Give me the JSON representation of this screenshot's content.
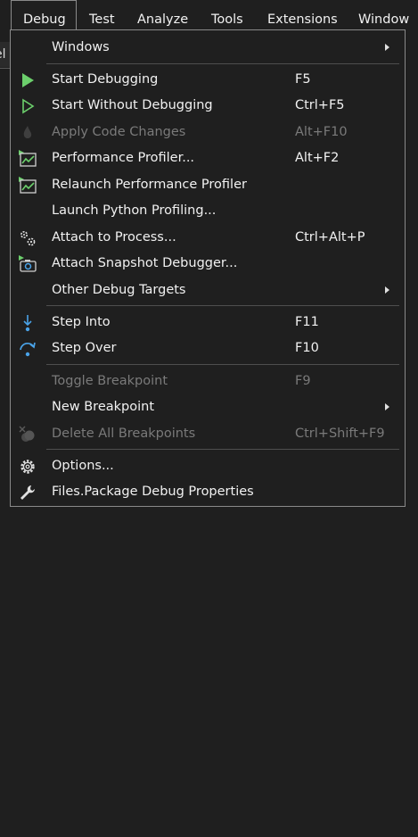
{
  "menubar": {
    "items": [
      {
        "label": "Debug"
      },
      {
        "label": "Test"
      },
      {
        "label": "Analyze"
      },
      {
        "label": "Tools"
      },
      {
        "label": "Extensions"
      },
      {
        "label": "Window"
      }
    ]
  },
  "background_tab_fragment": "el",
  "menu": {
    "items": [
      {
        "label": "Windows",
        "shortcut": "",
        "submenu": true
      },
      {
        "label": "Start Debugging",
        "shortcut": "F5",
        "icon": "play-filled-icon"
      },
      {
        "label": "Start Without Debugging",
        "shortcut": "Ctrl+F5",
        "icon": "play-outline-icon"
      },
      {
        "label": "Apply Code Changes",
        "shortcut": "Alt+F10",
        "icon": "flame-icon",
        "disabled": true
      },
      {
        "label": "Performance Profiler...",
        "shortcut": "Alt+F2",
        "icon": "performance-profiler-icon"
      },
      {
        "label": "Relaunch Performance Profiler",
        "shortcut": "",
        "icon": "relaunch-profiler-icon"
      },
      {
        "label": "Launch Python Profiling...",
        "shortcut": ""
      },
      {
        "label": "Attach to Process...",
        "shortcut": "Ctrl+Alt+P",
        "icon": "gears-icon"
      },
      {
        "label": "Attach Snapshot Debugger...",
        "shortcut": "",
        "icon": "camera-play-icon"
      },
      {
        "label": "Other Debug Targets",
        "shortcut": "",
        "submenu": true
      },
      {
        "label": "Step Into",
        "shortcut": "F11",
        "icon": "step-into-icon"
      },
      {
        "label": "Step Over",
        "shortcut": "F10",
        "icon": "step-over-icon"
      },
      {
        "label": "Toggle Breakpoint",
        "shortcut": "F9",
        "disabled": true
      },
      {
        "label": "New Breakpoint",
        "shortcut": "",
        "submenu": true
      },
      {
        "label": "Delete All Breakpoints",
        "shortcut": "Ctrl+Shift+F9",
        "icon": "delete-breakpoints-icon",
        "disabled": true
      },
      {
        "label": "Options...",
        "shortcut": "",
        "icon": "gear-icon"
      },
      {
        "label": "Files.Package Debug Properties",
        "shortcut": "",
        "icon": "wrench-icon"
      }
    ]
  },
  "colors": {
    "background": "#1f1f1f",
    "text": "#f1f1f1",
    "disabled_text": "#7a7a7a",
    "accent_green": "#6ccf6c",
    "accent_blue": "#4aa3e8",
    "border": "#8a8a8a"
  }
}
